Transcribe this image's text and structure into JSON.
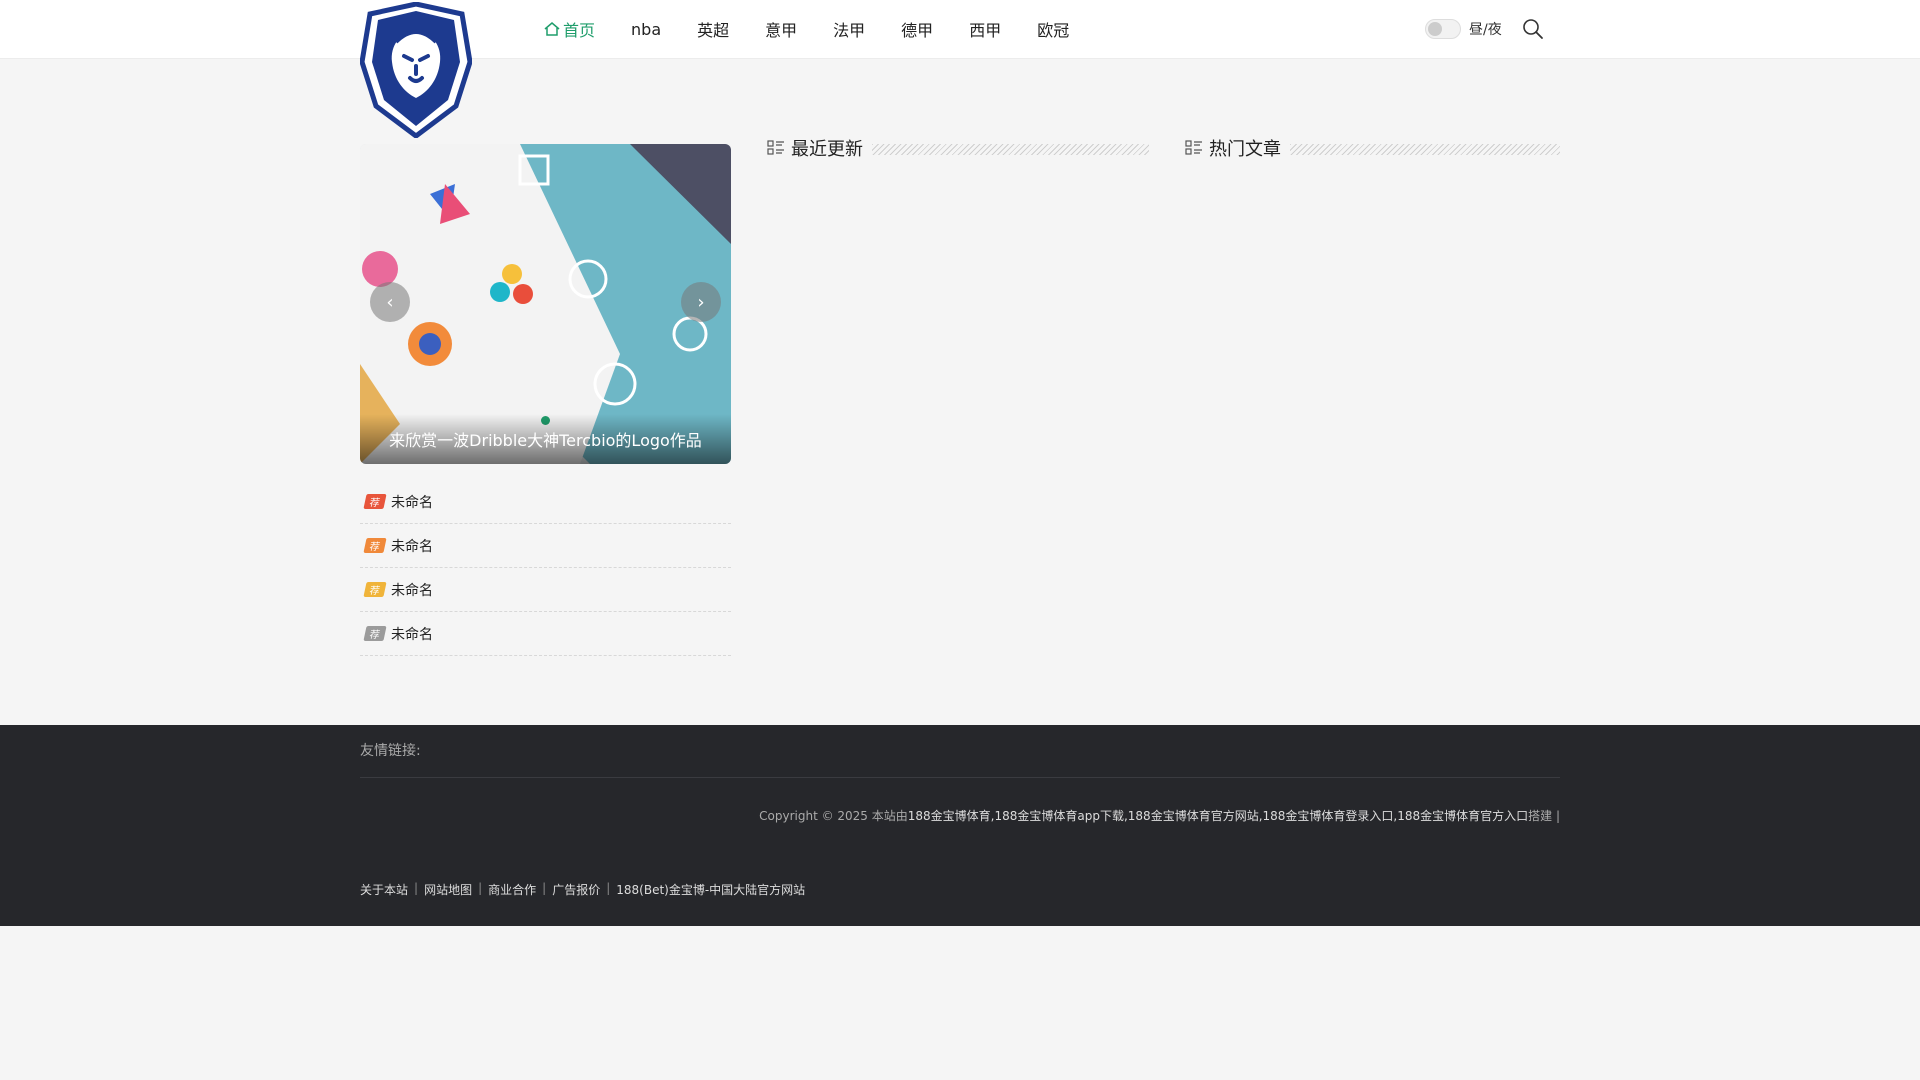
{
  "nav": {
    "items": [
      {
        "label": "首页",
        "active": true
      },
      {
        "label": "nba"
      },
      {
        "label": "英超"
      },
      {
        "label": "意甲"
      },
      {
        "label": "法甲"
      },
      {
        "label": "德甲"
      },
      {
        "label": "西甲"
      },
      {
        "label": "欧冠"
      }
    ]
  },
  "tools": {
    "theme_label": "昼/夜"
  },
  "slider": {
    "caption": "来欣赏一波Dribble大神Tercbio的Logo作品",
    "prev_icon": "‹",
    "next_icon": "›"
  },
  "recommended": {
    "badge": "荐",
    "items": [
      {
        "title": "未命名",
        "color": "#e8553b"
      },
      {
        "title": "未命名",
        "color": "#f0893a"
      },
      {
        "title": "未命名",
        "color": "#f0b43a"
      },
      {
        "title": "未命名",
        "color": "#9b9b9b"
      }
    ]
  },
  "sections": {
    "recent": "最近更新",
    "popular": "热门文章"
  },
  "footer": {
    "friend_links": "友情链接:",
    "copyright_prefix": "Copyright © 2025 本站由",
    "copyright_brand": "188金宝博体育,188金宝博体育app下载,188金宝博体育官方网站,188金宝博体育登录入口,188金宝博体育官方入口",
    "copyright_suffix": "搭建 |",
    "links": [
      "关于本站",
      "网站地图",
      "商业合作",
      "广告报价",
      "188(Bet)金宝博-中国大陆官方网站"
    ]
  },
  "colors": {
    "accent": "#1f9d6b",
    "footer_bg": "#26272b"
  }
}
